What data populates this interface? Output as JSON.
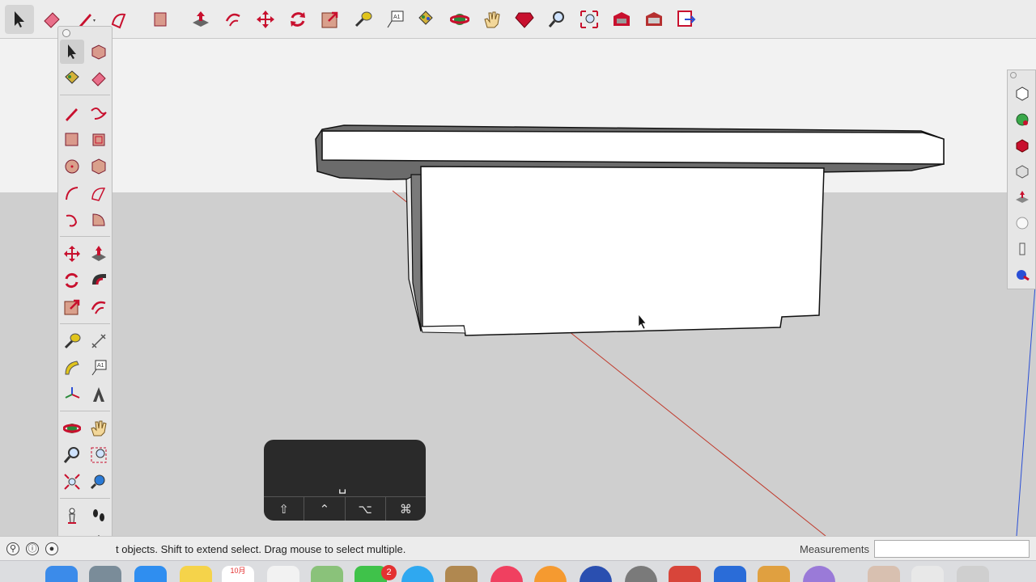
{
  "toolbar": {
    "tools": [
      {
        "id": "select",
        "icon": "arrow-cursor-icon"
      },
      {
        "id": "eraser",
        "icon": "eraser-icon"
      },
      {
        "id": "line",
        "icon": "pencil-icon"
      },
      {
        "id": "arc",
        "icon": "arc-icon"
      },
      {
        "id": "rectangle",
        "icon": "rectangle-icon"
      },
      {
        "id": "push-pull",
        "icon": "push-pull-icon"
      },
      {
        "id": "offset",
        "icon": "offset-icon"
      },
      {
        "id": "move",
        "icon": "move-icon"
      },
      {
        "id": "rotate",
        "icon": "rotate-icon"
      },
      {
        "id": "scale",
        "icon": "scale-icon"
      },
      {
        "id": "tape-measure",
        "icon": "tape-measure-icon"
      },
      {
        "id": "text",
        "icon": "text-label-icon"
      },
      {
        "id": "paint-bucket",
        "icon": "paint-bucket-icon"
      },
      {
        "id": "orbit",
        "icon": "orbit-icon"
      },
      {
        "id": "pan",
        "icon": "hand-icon"
      },
      {
        "id": "ruby",
        "icon": "ruby-gem-icon"
      },
      {
        "id": "zoom",
        "icon": "magnifier-icon"
      },
      {
        "id": "zoom-extents",
        "icon": "zoom-extents-icon"
      },
      {
        "id": "warehouse",
        "icon": "warehouse-icon"
      },
      {
        "id": "extensions",
        "icon": "extension-warehouse-icon"
      },
      {
        "id": "send-layout",
        "icon": "send-to-layout-icon"
      }
    ],
    "text_tool_label": "A1"
  },
  "palette": {
    "text_tool_label": "A1"
  },
  "keyhud": {
    "space": "␣",
    "keys": [
      "⇧",
      "⌃",
      "⌥",
      "⌘"
    ]
  },
  "statusbar": {
    "text": "t objects. Shift to extend select. Drag mouse to select multiple.",
    "measurements_label": "Measurements",
    "measurements_value": ""
  },
  "dock": {
    "calendar_month": "10月",
    "messages_badge": "2"
  },
  "colors": {
    "accent_red": "#c8102e",
    "axis_red": "#c0392b",
    "axis_blue": "#2a4fd6",
    "ground": "#cfcfcf",
    "sky": "#f2f2f2"
  }
}
